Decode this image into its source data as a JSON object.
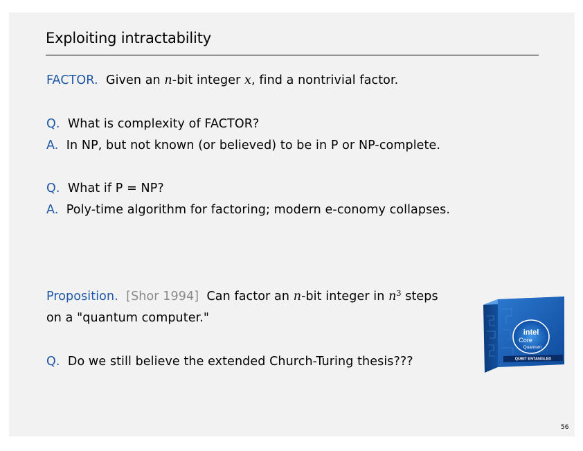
{
  "slide": {
    "title": "Exploiting intractability",
    "page_number": "56"
  },
  "factor": {
    "label": "FACTOR.",
    "text_a": "Given an ",
    "var_n": "n",
    "text_b": "-bit integer ",
    "var_x": "x",
    "text_c": ", find a nontrivial factor."
  },
  "qa1": {
    "q_label": "Q.",
    "q_text": "What is complexity of FACTOR?",
    "a_label": "A.",
    "a_text": "In NP, but not known (or believed) to be in P or NP-complete."
  },
  "qa2": {
    "q_label": "Q.",
    "q_text": "What if P = NP?",
    "a_label": "A.",
    "a_text": "Poly-time algorithm for factoring; modern e-conomy collapses."
  },
  "proposition": {
    "label": "Proposition.",
    "cite": "[Shor 1994]",
    "text_a": "Can factor an ",
    "var_n": "n",
    "text_b": "-bit integer in ",
    "var_n2": "n",
    "exp": "3",
    "text_c": " steps",
    "line2": "on a \"quantum computer.\""
  },
  "qa3": {
    "q_label": "Q.",
    "q_text": "Do we still believe the extended Church-Turing thesis???"
  },
  "chip_box": {
    "brand": "intel",
    "product": "Core",
    "sub": "Quantum",
    "banner": "QUBIT ENTANGLED",
    "colors": {
      "box_blue": "#1a5fb4",
      "box_dark": "#0b3a7a",
      "banner": "#0a2c66"
    }
  },
  "colors": {
    "label_blue": "#1d57a6",
    "cite_gray": "#8a8a8a",
    "background": "#f2f2f2"
  }
}
